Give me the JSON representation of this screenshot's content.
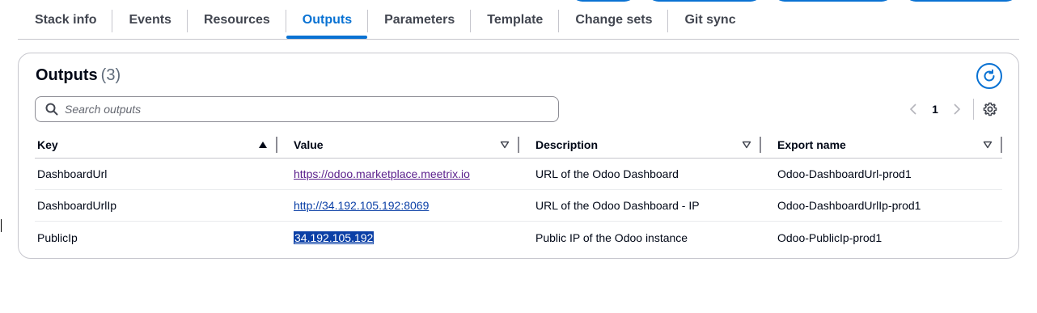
{
  "tabs": [
    {
      "label": "Stack info"
    },
    {
      "label": "Events"
    },
    {
      "label": "Resources"
    },
    {
      "label": "Outputs"
    },
    {
      "label": "Parameters"
    },
    {
      "label": "Template"
    },
    {
      "label": "Change sets"
    },
    {
      "label": "Git sync"
    }
  ],
  "active_tab": "Outputs",
  "outputs": {
    "title": "Outputs",
    "count": "(3)",
    "search_placeholder": "Search outputs",
    "page_number": "1",
    "columns": {
      "key": "Key",
      "value": "Value",
      "description": "Description",
      "export_name": "Export name"
    },
    "rows": [
      {
        "key": "DashboardUrl",
        "value": "https://odoo.marketplace.meetrix.io",
        "description": "URL of the Odoo Dashboard",
        "export_name": "Odoo-DashboardUrl-prod1"
      },
      {
        "key": "DashboardUrlIp",
        "value": "http://34.192.105.192:8069",
        "description": "URL of the Odoo Dashboard - IP",
        "export_name": "Odoo-DashboardUrlIp-prod1"
      },
      {
        "key": "PublicIp",
        "value": "34.192.105.192",
        "description": "Public IP of the Odoo instance",
        "export_name": "Odoo-PublicIp-prod1"
      }
    ]
  },
  "colors": {
    "accent": "#0972d3",
    "visited_link": "#5a1f8c",
    "link": "#0a3fa6",
    "selection": "#0a3fa6"
  },
  "icons": {
    "refresh": "refresh-icon",
    "search": "search-icon",
    "settings": "gear-icon",
    "prev": "chevron-left-icon",
    "next": "chevron-right-icon",
    "sort_asc": "caret-up-filled-icon",
    "sort_none": "caret-down-outline-icon"
  }
}
